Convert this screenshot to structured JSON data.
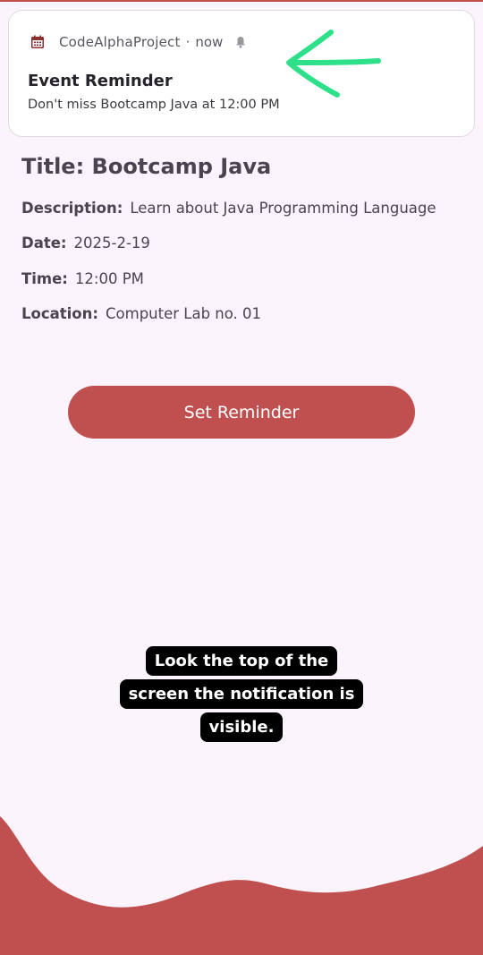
{
  "notification": {
    "app_name": "CodeAlphaProject",
    "separator": "·",
    "time": "now",
    "title": "Event Reminder",
    "body": "Don't miss Bootcamp Java at 12:00 PM",
    "icons": [
      "calendar-icon",
      "bell-icon"
    ]
  },
  "annotation": {
    "arrow_color": "#2ee08a"
  },
  "event": {
    "title_label": "Title:",
    "title_value": "Bootcamp Java",
    "description_label": "Description:",
    "description_value": "Learn about Java Programming Language",
    "date_label": "Date:",
    "date_value": "2025-2-19",
    "time_label": "Time:",
    "time_value": "12:00 PM",
    "location_label": "Location:",
    "location_value": "Computer Lab no. 01"
  },
  "button": {
    "label": "Set Reminder"
  },
  "caption": {
    "text": "Look the top of the screen the notification is visible."
  },
  "colors": {
    "accent": "#c05050",
    "background": "#fcf4fc",
    "text": "#4a4450"
  }
}
